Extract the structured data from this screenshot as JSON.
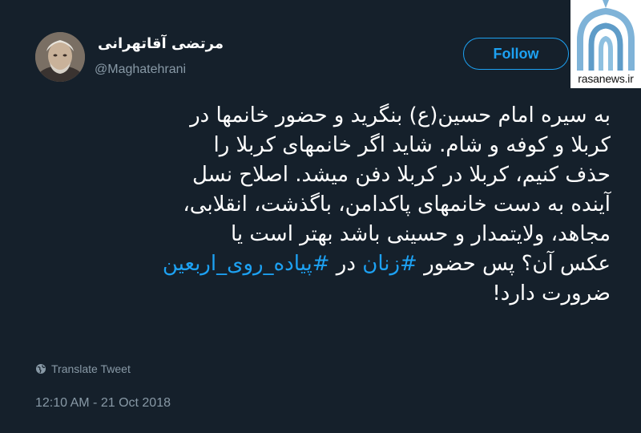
{
  "user": {
    "display_name": "مرتضی آقاتهرانی",
    "handle": "@Maghatehrani"
  },
  "follow_label": "Follow",
  "watermark_text": "rasanews.ir",
  "tweet": {
    "line1": "به سیره امام حسین(ع) بنگرید و حضور خانمها در",
    "line2": "کربلا و کوفه و شام. شاید اگر خانمهای کربلا را",
    "line3": "حذف کنیم، کربلا در کربلا دفن میشد. اصلاح نسل",
    "line4": "آینده به دست خانمهای پاکدامن، باگذشت، انقلابی،",
    "line5": "مجاهد، ولایتمدار و حسینی باشد بهتر است یا",
    "line6_pre": "عکس آن؟ پس حضور ",
    "hashtag1": "#زنان",
    "line6_mid": " در ",
    "hashtag2": "#پیاده_روی_اربعین",
    "line7": "ضرورت دارد!"
  },
  "translate_label": "Translate Tweet",
  "timestamp": "12:10 AM - 21 Oct 2018",
  "icons": {
    "translate": "globe-icon"
  },
  "colors": {
    "background": "#15202b",
    "accent": "#1da1f2",
    "secondary_text": "#8899a6"
  }
}
